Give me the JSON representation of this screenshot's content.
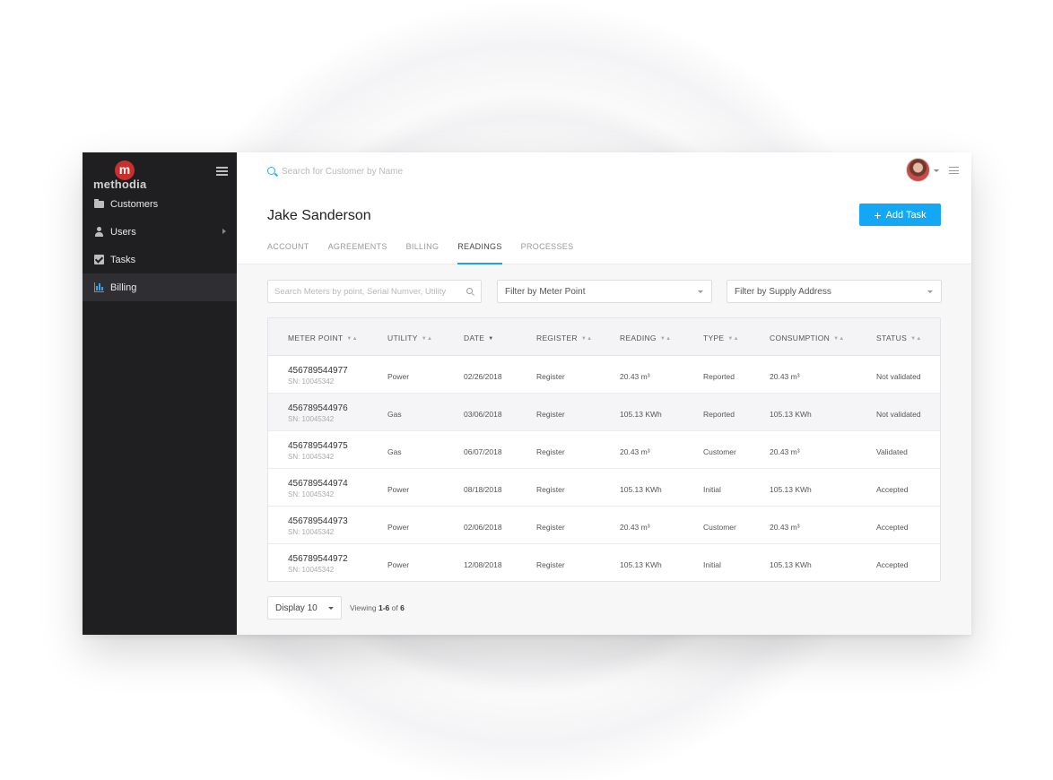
{
  "brand": {
    "logo_letter": "m",
    "name": "methodia"
  },
  "sidebar": {
    "items": [
      {
        "label": "Customers",
        "icon": "folder-icon"
      },
      {
        "label": "Users",
        "icon": "user-icon"
      },
      {
        "label": "Tasks",
        "icon": "checkbox-icon"
      },
      {
        "label": "Billing",
        "icon": "bar-chart-icon"
      }
    ]
  },
  "header": {
    "search_placeholder": "Search for Customer by Name",
    "customer_name": "Jake Sanderson",
    "add_task_label": "Add Task",
    "add_task_icon": "+"
  },
  "tabs": [
    "ACCOUNT",
    "AGREEMENTS",
    "BILLING",
    "READINGS",
    "PROCESSES"
  ],
  "filters": {
    "search_placeholder": "Search Meters by point, Serial Numver, Utility",
    "meter_point": "Filter by Meter Point",
    "supply_address": "Filter by Supply Address"
  },
  "table": {
    "columns": [
      "METER POINT",
      "UTILITY",
      "DATE",
      "REGISTER",
      "READING",
      "TYPE",
      "CONSUMPTION",
      "STATUS"
    ],
    "rows": [
      {
        "meter": "456789544977",
        "sn": "SN: 10045342",
        "utility": "Power",
        "date": "02/26/2018",
        "register": "Register",
        "reading": "20.43 m³",
        "type": "Reported",
        "consumption": "20.43 m³",
        "status": "Not validated"
      },
      {
        "meter": "456789544976",
        "sn": "SN: 10045342",
        "utility": "Gas",
        "date": "03/06/2018",
        "register": "Register",
        "reading": "105.13 KWh",
        "type": "Reported",
        "consumption": "105.13 KWh",
        "status": "Not validated"
      },
      {
        "meter": "456789544975",
        "sn": "SN: 10045342",
        "utility": "Gas",
        "date": "06/07/2018",
        "register": "Register",
        "reading": "20.43 m³",
        "type": "Customer",
        "consumption": "20.43 m³",
        "status": "Validated"
      },
      {
        "meter": "456789544974",
        "sn": "SN: 10045342",
        "utility": "Power",
        "date": "08/18/2018",
        "register": "Register",
        "reading": "105.13 KWh",
        "type": "Initial",
        "consumption": "105.13 KWh",
        "status": "Accepted"
      },
      {
        "meter": "456789544973",
        "sn": "SN: 10045342",
        "utility": "Power",
        "date": "02/06/2018",
        "register": "Register",
        "reading": "20.43 m³",
        "type": "Customer",
        "consumption": "20.43 m³",
        "status": "Accepted"
      },
      {
        "meter": "456789544972",
        "sn": "SN: 10045342",
        "utility": "Power",
        "date": "12/08/2018",
        "register": "Register",
        "reading": "105.13 KWh",
        "type": "Initial",
        "consumption": "105.13 KWh",
        "status": "Accepted"
      }
    ]
  },
  "footer": {
    "display_label": "Display 10",
    "viewing_prefix": "Viewing",
    "viewing_range": "1-6",
    "viewing_of": "of",
    "viewing_total": "6"
  },
  "colors": {
    "accent": "#14a7f5",
    "sidebar": "#1f1f22",
    "logo": "#c9302c"
  }
}
